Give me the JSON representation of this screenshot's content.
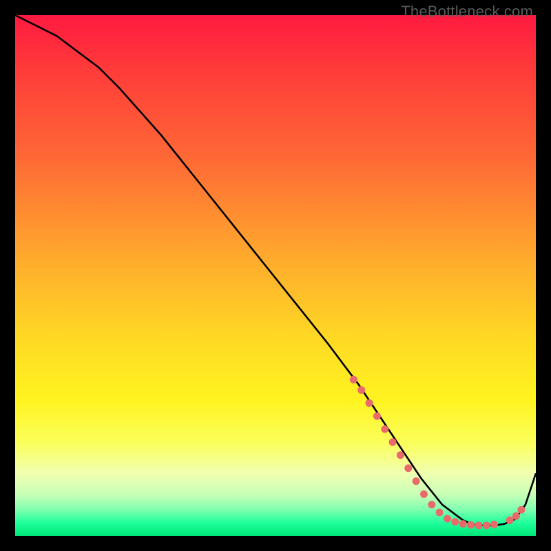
{
  "watermark": "TheBottleneck.com",
  "chart_data": {
    "type": "line",
    "title": "",
    "xlabel": "",
    "ylabel": "",
    "xlim": [
      0,
      100
    ],
    "ylim": [
      0,
      100
    ],
    "series": [
      {
        "name": "curve",
        "x": [
          0,
          4,
          8,
          12,
          16,
          20,
          28,
          36,
          44,
          52,
          60,
          66,
          70,
          74,
          78,
          82,
          86,
          88,
          90,
          92,
          94,
          96,
          98,
          100
        ],
        "y": [
          100,
          98,
          96,
          93,
          90,
          86,
          77,
          67,
          57,
          47,
          37,
          29,
          23,
          17,
          11,
          6,
          3,
          2.2,
          2,
          2,
          2.3,
          3.2,
          6,
          12
        ]
      }
    ],
    "markers": [
      {
        "x": 65.0,
        "y": 30.0
      },
      {
        "x": 66.5,
        "y": 28.0
      },
      {
        "x": 68.0,
        "y": 25.5
      },
      {
        "x": 69.5,
        "y": 23.0
      },
      {
        "x": 71.0,
        "y": 20.5
      },
      {
        "x": 72.5,
        "y": 18.0
      },
      {
        "x": 74.0,
        "y": 15.5
      },
      {
        "x": 75.5,
        "y": 13.0
      },
      {
        "x": 77.0,
        "y": 10.5
      },
      {
        "x": 78.5,
        "y": 8.0
      },
      {
        "x": 80.0,
        "y": 6.0
      },
      {
        "x": 81.5,
        "y": 4.5
      },
      {
        "x": 83.0,
        "y": 3.3
      },
      {
        "x": 84.5,
        "y": 2.7
      },
      {
        "x": 86.0,
        "y": 2.3
      },
      {
        "x": 87.5,
        "y": 2.1
      },
      {
        "x": 89.0,
        "y": 2.0
      },
      {
        "x": 90.5,
        "y": 2.0
      },
      {
        "x": 92.0,
        "y": 2.2
      },
      {
        "x": 95.0,
        "y": 3.0
      },
      {
        "x": 96.2,
        "y": 3.8
      },
      {
        "x": 97.2,
        "y": 5.0
      }
    ],
    "marker_color": "#e86a6a",
    "curve_color": "#000000"
  }
}
